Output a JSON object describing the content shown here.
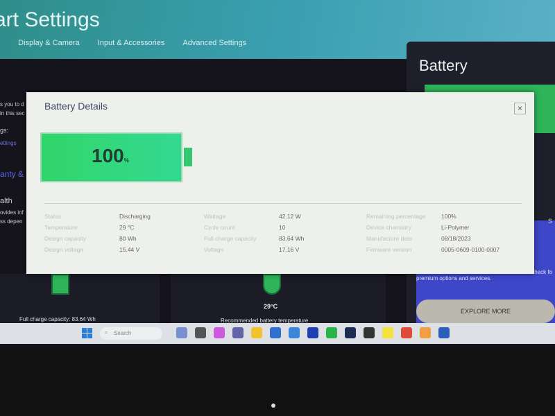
{
  "app": {
    "title": "art Settings",
    "tabs": [
      "o",
      "Display & Camera",
      "Input & Accessories",
      "Advanced Settings"
    ],
    "side_fragments": [
      "s you to d",
      "in this sec",
      "gs:",
      "ettings",
      "anty &",
      "alth",
      "ovides inf",
      "ss depen"
    ]
  },
  "battery_panel": {
    "title": "Battery",
    "promo_text": "premium options and services.",
    "promo_partial": "Check fo",
    "explore_label": "EXPLORE MORE",
    "side_label": "S"
  },
  "cards": {
    "full_charge": "Full charge capacity: 83.64 Wh",
    "temperature": "29°C",
    "temp_caption": "Recommended battery temperature"
  },
  "dialog": {
    "title": "Battery Details",
    "close": "×",
    "level": "100",
    "level_unit": "%",
    "level_percent": 100,
    "details": [
      {
        "label": "Status",
        "value": "Discharging"
      },
      {
        "label": "Wattage",
        "value": "42.12 W"
      },
      {
        "label": "Remaining percentage",
        "value": "100%"
      },
      {
        "label": "Temperature",
        "value": "29 °C"
      },
      {
        "label": "Cycle count",
        "value": "10"
      },
      {
        "label": "Device chemistry",
        "value": "Li-Polymer"
      },
      {
        "label": "Design capacity",
        "value": "80 Wh"
      },
      {
        "label": "Full charge capacity",
        "value": "83.64 Wh"
      },
      {
        "label": "Manufacture date",
        "value": "08/18/2023"
      },
      {
        "label": "Design voltage",
        "value": "15.44 V"
      },
      {
        "label": "Voltage",
        "value": "17.16 V"
      },
      {
        "label": "Firmware version",
        "value": "0005-0609-0100-0007"
      }
    ]
  },
  "taskbar": {
    "search_placeholder": "Search",
    "icons": [
      {
        "name": "widgets",
        "color": "#7a8fd0"
      },
      {
        "name": "task-view",
        "color": "#555"
      },
      {
        "name": "copilot",
        "color": "#d05adc"
      },
      {
        "name": "teams",
        "color": "#6264a7"
      },
      {
        "name": "file-explorer",
        "color": "#f2c230"
      },
      {
        "name": "store",
        "color": "#2f6fd0"
      },
      {
        "name": "app",
        "color": "#3a86d8"
      },
      {
        "name": "l-app",
        "color": "#1f3fb0"
      },
      {
        "name": "whatsapp",
        "color": "#2ab34a"
      },
      {
        "name": "steam",
        "color": "#1b2d52"
      },
      {
        "name": "n-app",
        "color": "#333"
      },
      {
        "name": "norton",
        "color": "#f2e23a"
      },
      {
        "name": "chrome",
        "color": "#e04a3a"
      },
      {
        "name": "paint",
        "color": "#f0a040"
      },
      {
        "name": "word",
        "color": "#2b5fb8"
      }
    ]
  }
}
